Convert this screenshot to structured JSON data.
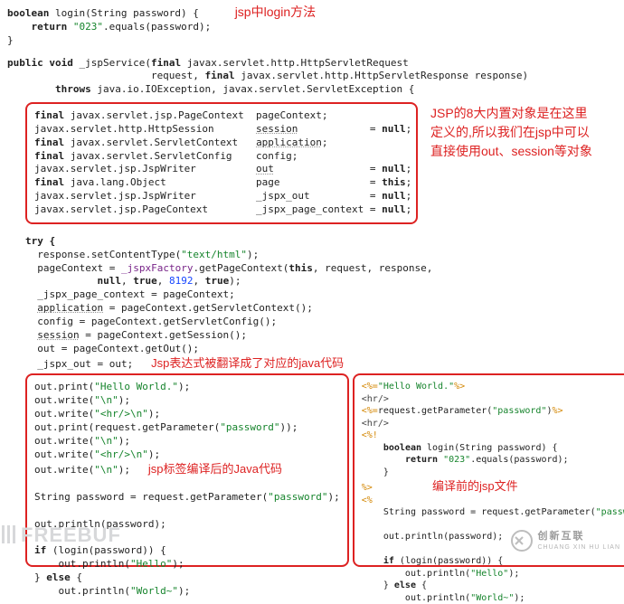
{
  "top_block": {
    "l1_a": "boolean",
    "l1_b": " login(String password) {",
    "l2_a": "    return ",
    "l2_b": "\"023\"",
    "l2_c": ".equals(password);",
    "l3": "}",
    "ann": "jsp中login方法"
  },
  "svc": {
    "l1_a": "public void",
    "l1_b": " _jspService(",
    "l1_c": "final",
    "l1_d": " javax.servlet.http.HttpServletRequest",
    "l2_a": "                        request, ",
    "l2_b": "final",
    "l2_c": " javax.servlet.http.HttpServletResponse response)",
    "l3_a": "        throws ",
    "l3_b": "java.io.IOException, javax.servlet.ServletException {"
  },
  "decl": {
    "r1": "final javax.servlet.jsp.PageContext  pageContext;",
    "r2": "javax.servlet.http.HttpSession       session            = null;",
    "r3": "final javax.servlet.ServletContext   application;",
    "r4": "final javax.servlet.ServletConfig    config;",
    "r5": "javax.servlet.jsp.JspWriter          out                = null;",
    "r6": "final java.lang.Object               page               = this;",
    "r7": "javax.servlet.jsp.JspWriter          _jspx_out          = null;",
    "r8": "javax.servlet.jsp.PageContext        _jspx_page_context = null;",
    "ann_l1": "JSP的8大内置对象是在这里",
    "ann_l2": "定义的,所以我们在jsp中可以",
    "ann_l3": "直接使用out、session等对象"
  },
  "try_block": {
    "l1": "try {",
    "l2_a": "  response.setContentType(",
    "l2_s": "\"text/html\"",
    "l2_b": ");",
    "l3_a": "  pageContext = ",
    "l3_f": "_jspxFactory",
    "l3_b": ".getPageContext(",
    "l3_kw": "this",
    "l3_c": ", request, response,",
    "l4_a": "            ",
    "l4_n1": "null",
    "l4_b": ", ",
    "l4_n2": "true",
    "l4_c": ", ",
    "l4_num": "8192",
    "l4_d": ", ",
    "l4_n3": "true",
    "l4_e": ");",
    "l5": "  _jspx_page_context = pageContext;",
    "l6_a": "  ",
    "l6_u": "application",
    "l6_b": " = pageContext.getServletContext();",
    "l7": "  config = pageContext.getServletConfig();",
    "l8_a": "  ",
    "l8_u": "session",
    "l8_b": " = pageContext.getSession();",
    "l9": "  out = pageContext.getOut();",
    "l10": "  _jspx_out = out;",
    "ann": "Jsp表达式被翻译成了对应的java代码"
  },
  "left": {
    "l1_a": "out.print(",
    "l1_s": "\"Hello World.\"",
    "l1_b": ");",
    "l2_a": "out.write(",
    "l2_s": "\"\\n\"",
    "l2_b": ");",
    "l3_a": "out.write(",
    "l3_s": "\"<hr/>\\n\"",
    "l3_b": ");",
    "l4_a": "out.print(request.getParameter(",
    "l4_s": "\"password\"",
    "l4_b": "));",
    "l5_a": "out.write(",
    "l5_s": "\"\\n\"",
    "l5_b": ");",
    "l6_a": "out.write(",
    "l6_s": "\"<hr/>\\n\"",
    "l6_b": ");",
    "l7_a": "out.write(",
    "l7_s": "\"\\n\"",
    "l7_b": ");",
    "ann": "jsp标签编译后的Java代码",
    "l8_a": "String password = request.getParameter(",
    "l8_s": "\"password\"",
    "l8_b": ");",
    "l9": "out.println(password);",
    "l10_a": "if",
    "l10_b": " (login(password)) {",
    "l11_a": "    out.println(",
    "l11_s": "\"Hello\"",
    "l11_b": ");",
    "l12_a": "} ",
    "l12_kw": "else",
    "l12_b": " {",
    "l13_a": "    out.println(",
    "l13_s": "\"World~\"",
    "l13_b": ");",
    "l14": "}"
  },
  "right": {
    "r1_a": "<%=",
    "r1_s": "\"Hello World.\"",
    "r1_b": "%>",
    "r2": "<hr/>",
    "r3_a": "<%=",
    "r3_b": "request.getParameter(",
    "r3_s": "\"password\"",
    "r3_c": ")",
    "r3_d": "%>",
    "r4": "<hr/>",
    "r5": "<%!",
    "r6_a": "    ",
    "r6_kw": "boolean",
    "r6_b": " login(String password) {",
    "r7_a": "        ",
    "r7_kw": "return",
    "r7_b": " ",
    "r7_s": "\"023\"",
    "r7_c": ".equals(password);",
    "r8": "    }",
    "r9": "%>",
    "ann": "编译前的jsp文件",
    "r10": "<%",
    "r11_a": "    String password = request.getParameter(",
    "r11_s": "\"password\"",
    "r11_b": ");",
    "r12": "    out.println(password);",
    "r13_a": "    ",
    "r13_kw": "if",
    "r13_b": " (login(password)) {",
    "r14_a": "        out.println(",
    "r14_s": "\"Hello\"",
    "r14_b": ");",
    "r15_a": "    } ",
    "r15_kw": "else",
    "r15_b": " {",
    "r16_a": "        out.println(",
    "r16_s": "\"World~\"",
    "r16_b": ");",
    "r17": "    }",
    "r18": "%>"
  },
  "watermark_left": "FREEBUF",
  "watermark_right_cn": "创新互联",
  "watermark_right_en": "CHUANG XIN HU LIAN"
}
